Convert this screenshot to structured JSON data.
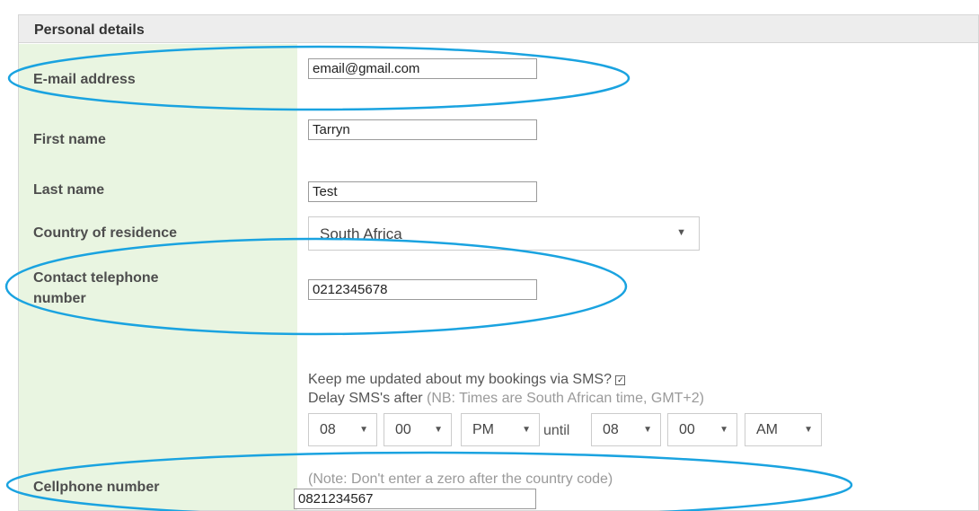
{
  "header": {
    "title": "Personal details"
  },
  "fields": {
    "email": {
      "label": "E-mail address",
      "value": "email@gmail.com"
    },
    "first_name": {
      "label": "First name",
      "value": "Tarryn"
    },
    "last_name": {
      "label": "Last name",
      "value": "Test"
    },
    "country": {
      "label": "Country of residence",
      "value": "South Africa"
    },
    "telephone": {
      "label_line1": "Contact telephone",
      "label_line2": "number",
      "value": "0212345678"
    },
    "cellphone": {
      "label": "Cellphone number",
      "value": "0821234567"
    }
  },
  "sms": {
    "keep_updated": "Keep me updated about my bookings via SMS?",
    "keep_updated_checked": true,
    "checkbox_glyph": "✓",
    "delay_label": "Delay SMS's after",
    "delay_note": "(NB: Times are South African time, GMT+2)",
    "from_hour": "08",
    "from_minute": "00",
    "from_ampm": "PM",
    "until_label": "until",
    "to_hour": "08",
    "to_minute": "00",
    "to_ampm": "AM"
  },
  "cell_note": "(Note: Don't enter a zero after the country code)",
  "icons": {
    "dropdown": "chevron-down-icon",
    "dropdown_glyph": "▼"
  },
  "colors": {
    "label_background": "#e9f5e1",
    "header_background": "#ededed",
    "annotation_ellipse": "#1aa3e0"
  }
}
